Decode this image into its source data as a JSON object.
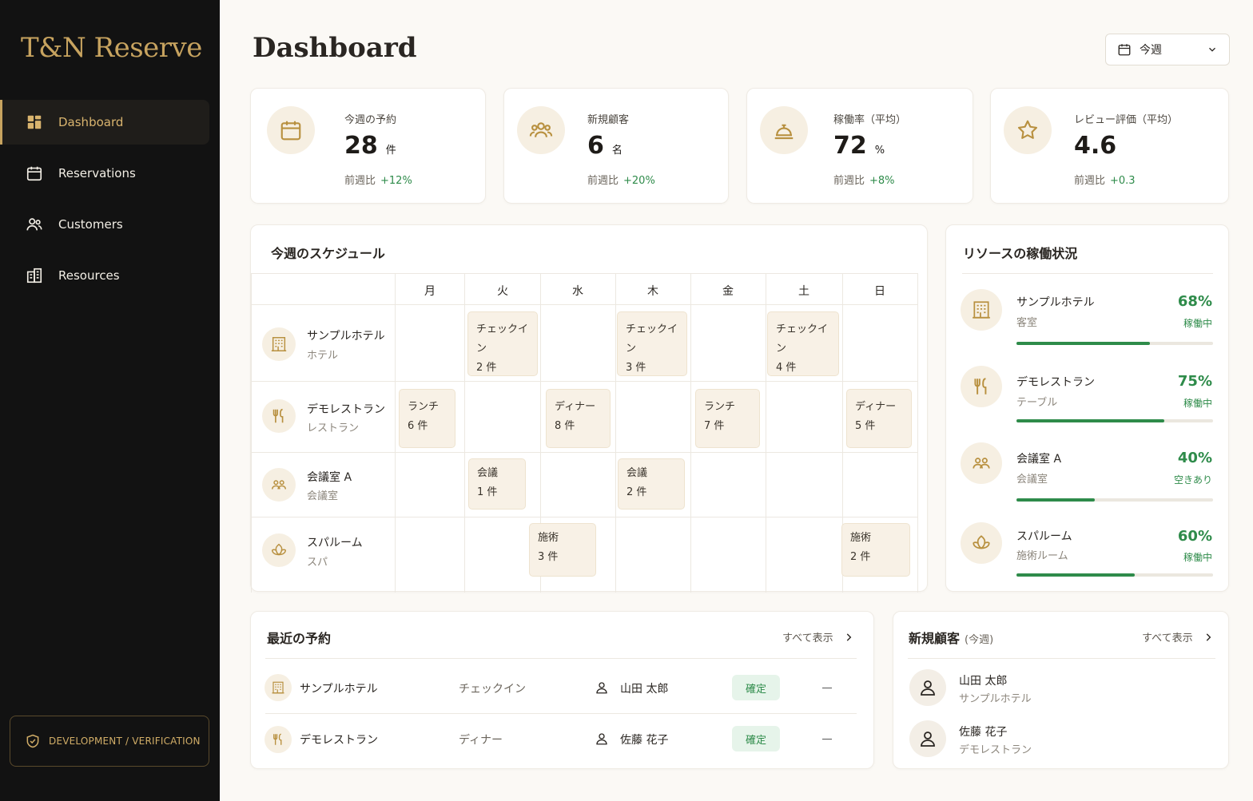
{
  "app": {
    "brand": "T&N Reserve"
  },
  "sidebar": {
    "items": [
      {
        "label": "Dashboard",
        "icon": "dashboard-icon",
        "active": true
      },
      {
        "label": "Reservations",
        "icon": "calendar-icon"
      },
      {
        "label": "Customers",
        "icon": "users-icon"
      },
      {
        "label": "Resources",
        "icon": "building-icon"
      }
    ],
    "env_label": "DEVELOPMENT / VERIFICATION"
  },
  "header": {
    "title": "Dashboard",
    "week_select": "今週"
  },
  "stats": [
    {
      "label": "今週の予約",
      "value": "28",
      "unit": "件",
      "delta_label": "前週比",
      "delta": "+12%",
      "icon": "calendar-icon"
    },
    {
      "label": "新規顧客",
      "value": "6",
      "unit": "名",
      "delta_label": "前週比",
      "delta": "+20%",
      "icon": "users-icon"
    },
    {
      "label": "稼働率（平均）",
      "value": "72",
      "unit": "%",
      "delta_label": "前週比",
      "delta": "+8%",
      "icon": "bell-icon"
    },
    {
      "label": "レビュー評価（平均）",
      "value": "4.6",
      "unit": "",
      "delta_label": "前週比",
      "delta": "+0.3",
      "icon": "star-icon"
    }
  ],
  "schedule": {
    "title": "今週のスケジュール",
    "days": [
      "月",
      "火",
      "水",
      "木",
      "金",
      "土",
      "日"
    ],
    "resources": [
      {
        "name": "サンプルホテル",
        "type": "ホテル",
        "icon": "hotel-icon"
      },
      {
        "name": "デモレストラン",
        "type": "レストラン",
        "icon": "utensils-icon"
      },
      {
        "name": "会議室 A",
        "type": "会議室",
        "icon": "meeting-icon"
      },
      {
        "name": "スパルーム",
        "type": "スパ",
        "icon": "lotus-icon"
      }
    ],
    "events": [
      {
        "label": "チェックイン",
        "count": "2 件"
      },
      {
        "label": "チェックイン",
        "count": "3 件"
      },
      {
        "label": "チェックイン",
        "count": "4 件"
      },
      {
        "label": "ランチ",
        "count": "6 件"
      },
      {
        "label": "ディナー",
        "count": "8 件"
      },
      {
        "label": "ランチ",
        "count": "7 件"
      },
      {
        "label": "ディナー",
        "count": "5 件"
      },
      {
        "label": "会議",
        "count": "1 件"
      },
      {
        "label": "会議",
        "count": "2 件"
      },
      {
        "label": "施術",
        "count": "3 件"
      },
      {
        "label": "施術",
        "count": "2 件"
      }
    ]
  },
  "utilization": {
    "title": "リソースの稼働状況",
    "items": [
      {
        "name": "サンプルホテル",
        "type": "客室",
        "pct": "68%",
        "value": 0.68,
        "status": "稼働中",
        "icon": "hotel-icon"
      },
      {
        "name": "デモレストラン",
        "type": "テーブル",
        "pct": "75%",
        "value": 0.75,
        "status": "稼働中",
        "icon": "utensils-icon"
      },
      {
        "name": "会議室 A",
        "type": "会議室",
        "pct": "40%",
        "value": 0.4,
        "status": "空きあり",
        "icon": "meeting-icon"
      },
      {
        "name": "スパルーム",
        "type": "施術ルーム",
        "pct": "60%",
        "value": 0.6,
        "status": "稼働中",
        "icon": "lotus-icon"
      }
    ]
  },
  "recent": {
    "title": "最近の予約",
    "view_all": "すべて表示",
    "rows": [
      {
        "resource": "サンプルホテル",
        "kind": "チェックイン",
        "customer": "山田 太郎",
        "status": "確定",
        "icon": "hotel-icon"
      },
      {
        "resource": "デモレストラン",
        "kind": "ディナー",
        "customer": "佐藤 花子",
        "status": "確定",
        "icon": "utensils-icon"
      }
    ]
  },
  "new_customers": {
    "title": "新規顧客",
    "subtitle": "(今週)",
    "view_all": "すべて表示",
    "items": [
      {
        "name": "山田 太郎",
        "resource": "サンプルホテル"
      },
      {
        "name": "佐藤 花子",
        "resource": "デモレストラン"
      }
    ]
  },
  "colors": {
    "gold": "#c7a35f",
    "sidebar": "#121212",
    "green": "#2e8b4a"
  }
}
